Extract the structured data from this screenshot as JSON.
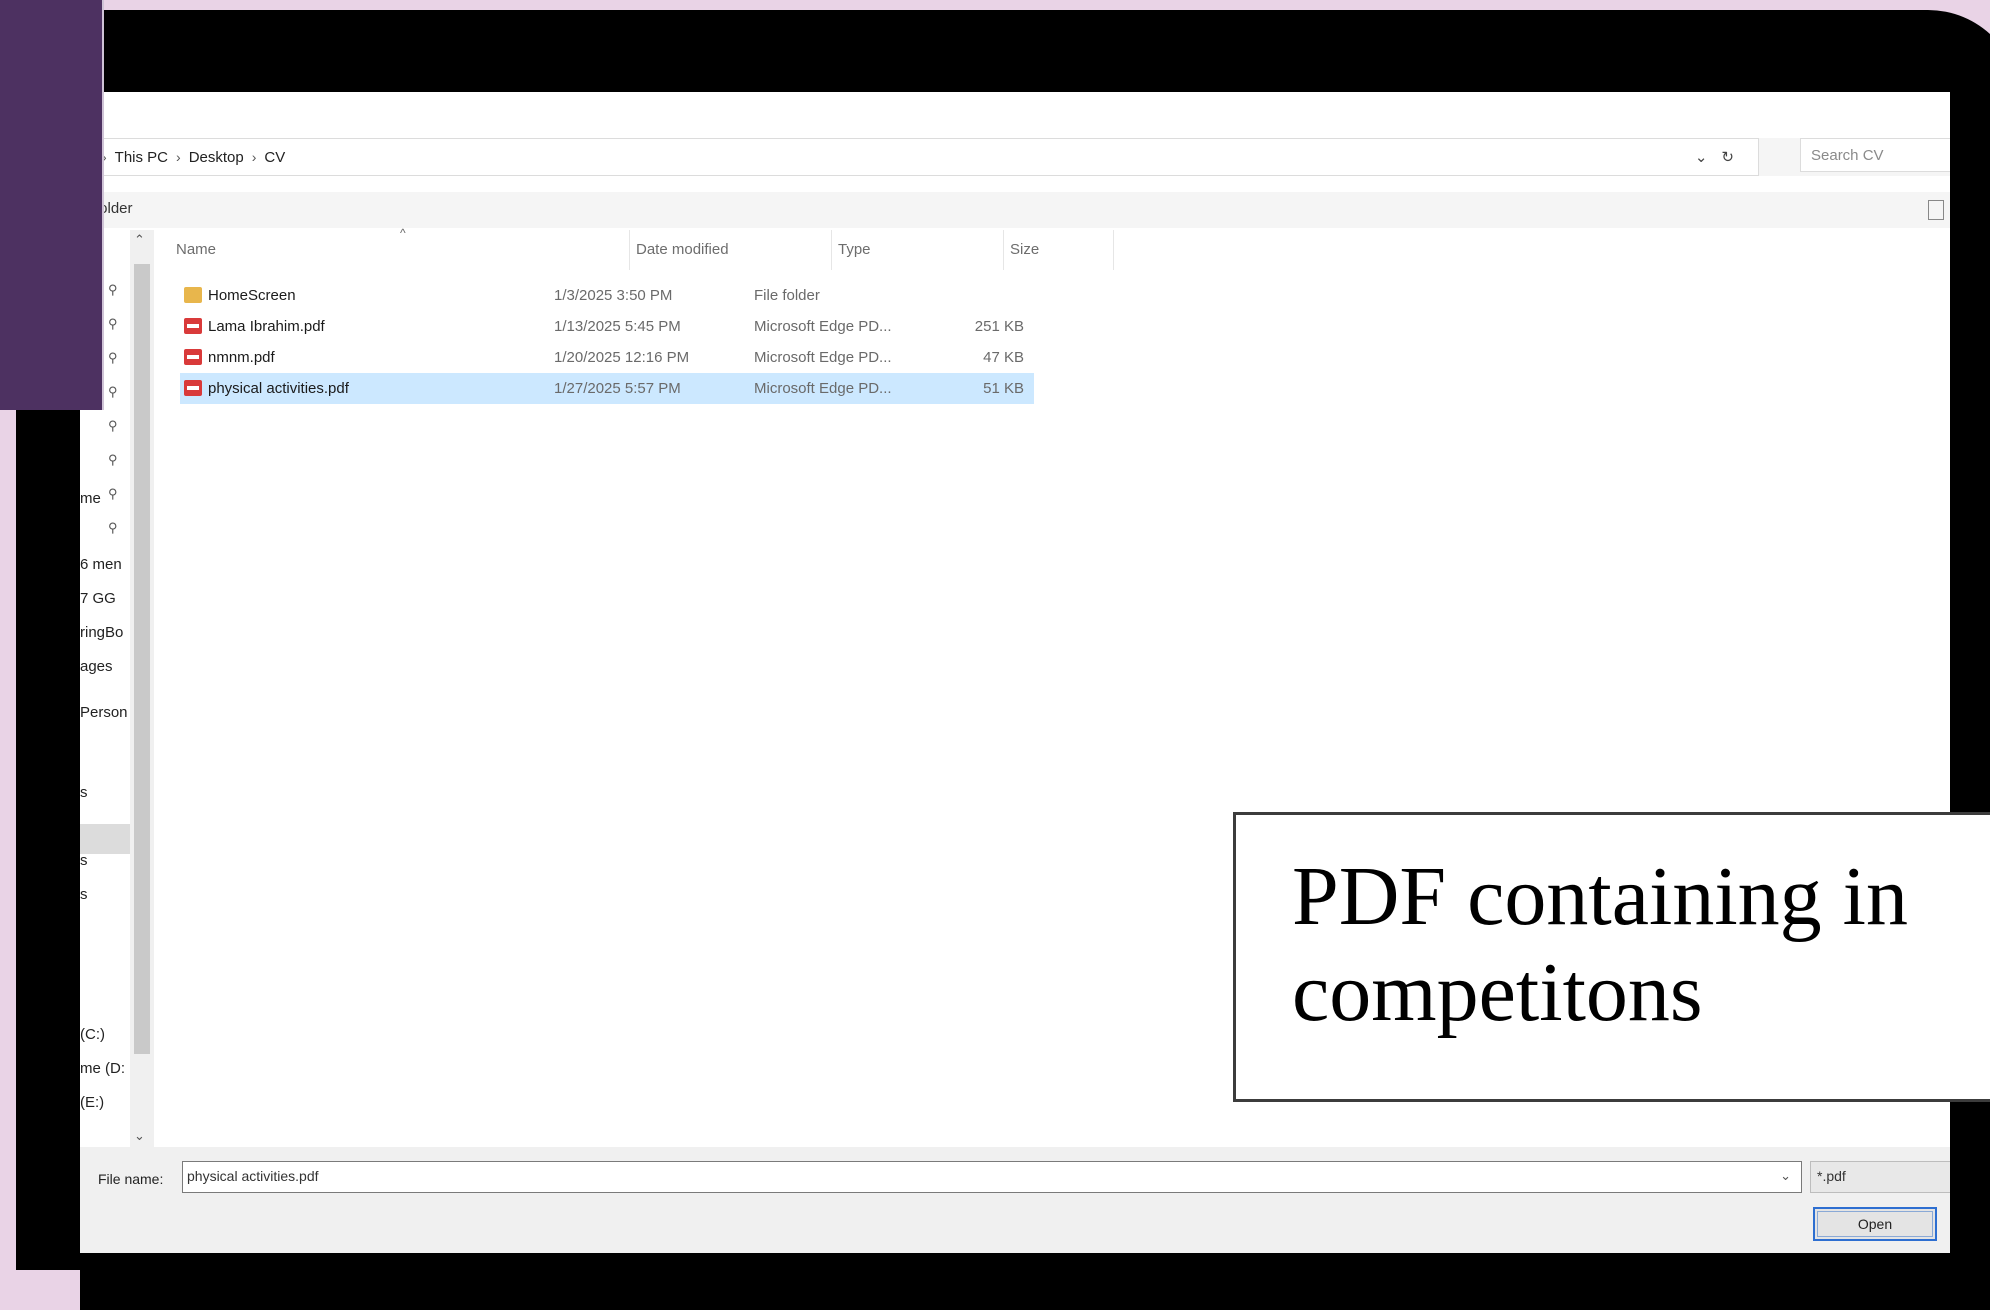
{
  "explorer": {
    "breadcrumb": [
      "This PC",
      "Desktop",
      "CV"
    ],
    "search_placeholder": "Search CV",
    "new_folder_label": "w folder",
    "columns": [
      "Name",
      "Date modified",
      "Type",
      "Size"
    ],
    "files": [
      {
        "name": "HomeScreen",
        "date": "1/3/2025 3:50 PM",
        "type": "File folder",
        "size": "",
        "icon": "folder-icon",
        "selected": false
      },
      {
        "name": "Lama Ibrahim.pdf",
        "date": "1/13/2025 5:45 PM",
        "type": "Microsoft Edge PD...",
        "size": "251 KB",
        "icon": "pdf-icon",
        "selected": false
      },
      {
        "name": "nmnm.pdf",
        "date": "1/20/2025 12:16 PM",
        "type": "Microsoft Edge PD...",
        "size": "47 KB",
        "icon": "pdf-icon",
        "selected": false
      },
      {
        "name": "physical activities.pdf",
        "date": "1/27/2025 5:57 PM",
        "type": "Microsoft Edge PD...",
        "size": "51 KB",
        "icon": "pdf-icon",
        "selected": true
      }
    ],
    "nav_items": [
      "me",
      "6 men",
      "7 GG",
      "ringBo",
      "ages",
      "Person",
      "s",
      "s",
      "s",
      "(C:)",
      "me (D:",
      "(E:)"
    ],
    "file_name_label": "File name:",
    "file_name_value": "physical activities.pdf",
    "filter_value": "*.pdf",
    "open_label": "Open"
  },
  "caption": {
    "line1": "PDF containing in",
    "line2": "competitons"
  },
  "colors": {
    "selection": "#cce8ff",
    "purple": "#4d3161",
    "background": "#e9d3e6"
  }
}
